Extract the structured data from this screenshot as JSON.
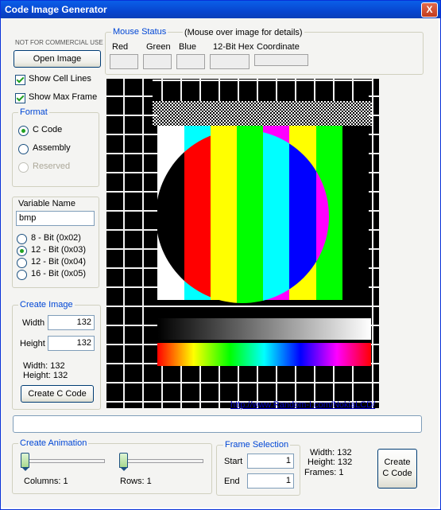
{
  "window": {
    "title": "Code Image Generator",
    "close_glyph": "X"
  },
  "left": {
    "notice": "NOT FOR COMMERCIAL USE",
    "open_image_label": "Open Image",
    "show_cell_lines_label": "Show Cell Lines",
    "show_cell_lines_checked": true,
    "show_max_frame_label": "Show Max Frame",
    "show_max_frame_checked": true
  },
  "format": {
    "legend": "Format",
    "options": [
      {
        "label": "C Code",
        "selected": true,
        "disabled": false
      },
      {
        "label": "Assembly",
        "selected": false,
        "disabled": false
      },
      {
        "label": "Reserved",
        "selected": false,
        "disabled": true
      }
    ]
  },
  "variable": {
    "title": "Variable Name",
    "value": "bmp",
    "options": [
      {
        "label": "8 - Bit (0x02)",
        "selected": false
      },
      {
        "label": "12 - Bit (0x03)",
        "selected": true
      },
      {
        "label": "12 - Bit (0x04)",
        "selected": false
      },
      {
        "label": "16 - Bit (0x05)",
        "selected": false
      }
    ]
  },
  "create_image": {
    "legend": "Create Image",
    "width_label": "Width",
    "width_value": "132",
    "height_label": "Height",
    "height_value": "132",
    "info_width": "Width: 132",
    "info_height": "Height: 132",
    "button_label": "Create C Code"
  },
  "mouse_status": {
    "legend": "Mouse Status",
    "hint": "(Mouse over image for details)",
    "red": "Red",
    "green": "Green",
    "blue": "Blue",
    "hex": "12-Bit Hex",
    "coordinate": "Coordinate"
  },
  "link": "http://www.Random-I.com/NokiaLCD/",
  "status_field": "",
  "animation": {
    "legend": "Create Animation",
    "columns_label": "Columns: 1",
    "rows_label": "Rows: 1",
    "columns_value": 1,
    "rows_value": 1
  },
  "frame_selection": {
    "legend": "Frame Selection",
    "start_label": "Start",
    "start_value": "1",
    "end_label": "End",
    "end_value": "1"
  },
  "summary": {
    "width": "Width: 132",
    "height": "Height: 132",
    "frames": "Frames: 1"
  },
  "create_c_code_button": {
    "line1": "Create",
    "line2": "C Code"
  },
  "colors": {
    "accent_blue": "#0046d5",
    "titlebar": "#0846d0",
    "check_green": "#21a121",
    "bars": [
      "#ffffff",
      "#00ffff",
      "#ffff00",
      "#00ff00",
      "#ff00ff",
      "#ff0000",
      "#0000ff",
      "#000000"
    ]
  }
}
